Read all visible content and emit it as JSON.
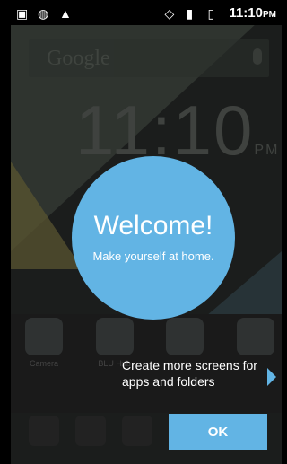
{
  "status": {
    "time": "11:10",
    "ampm": "PM"
  },
  "search": {
    "logo": "Google"
  },
  "clock": {
    "time": "11:10",
    "ampm": "PM"
  },
  "welcome": {
    "title": "Welcome!",
    "subtitle": "Make yourself at home."
  },
  "apps": [
    "Camera",
    "BLU Hub",
    "",
    ""
  ],
  "tip": "Create more screens for apps and folders",
  "ok_label": "OK"
}
